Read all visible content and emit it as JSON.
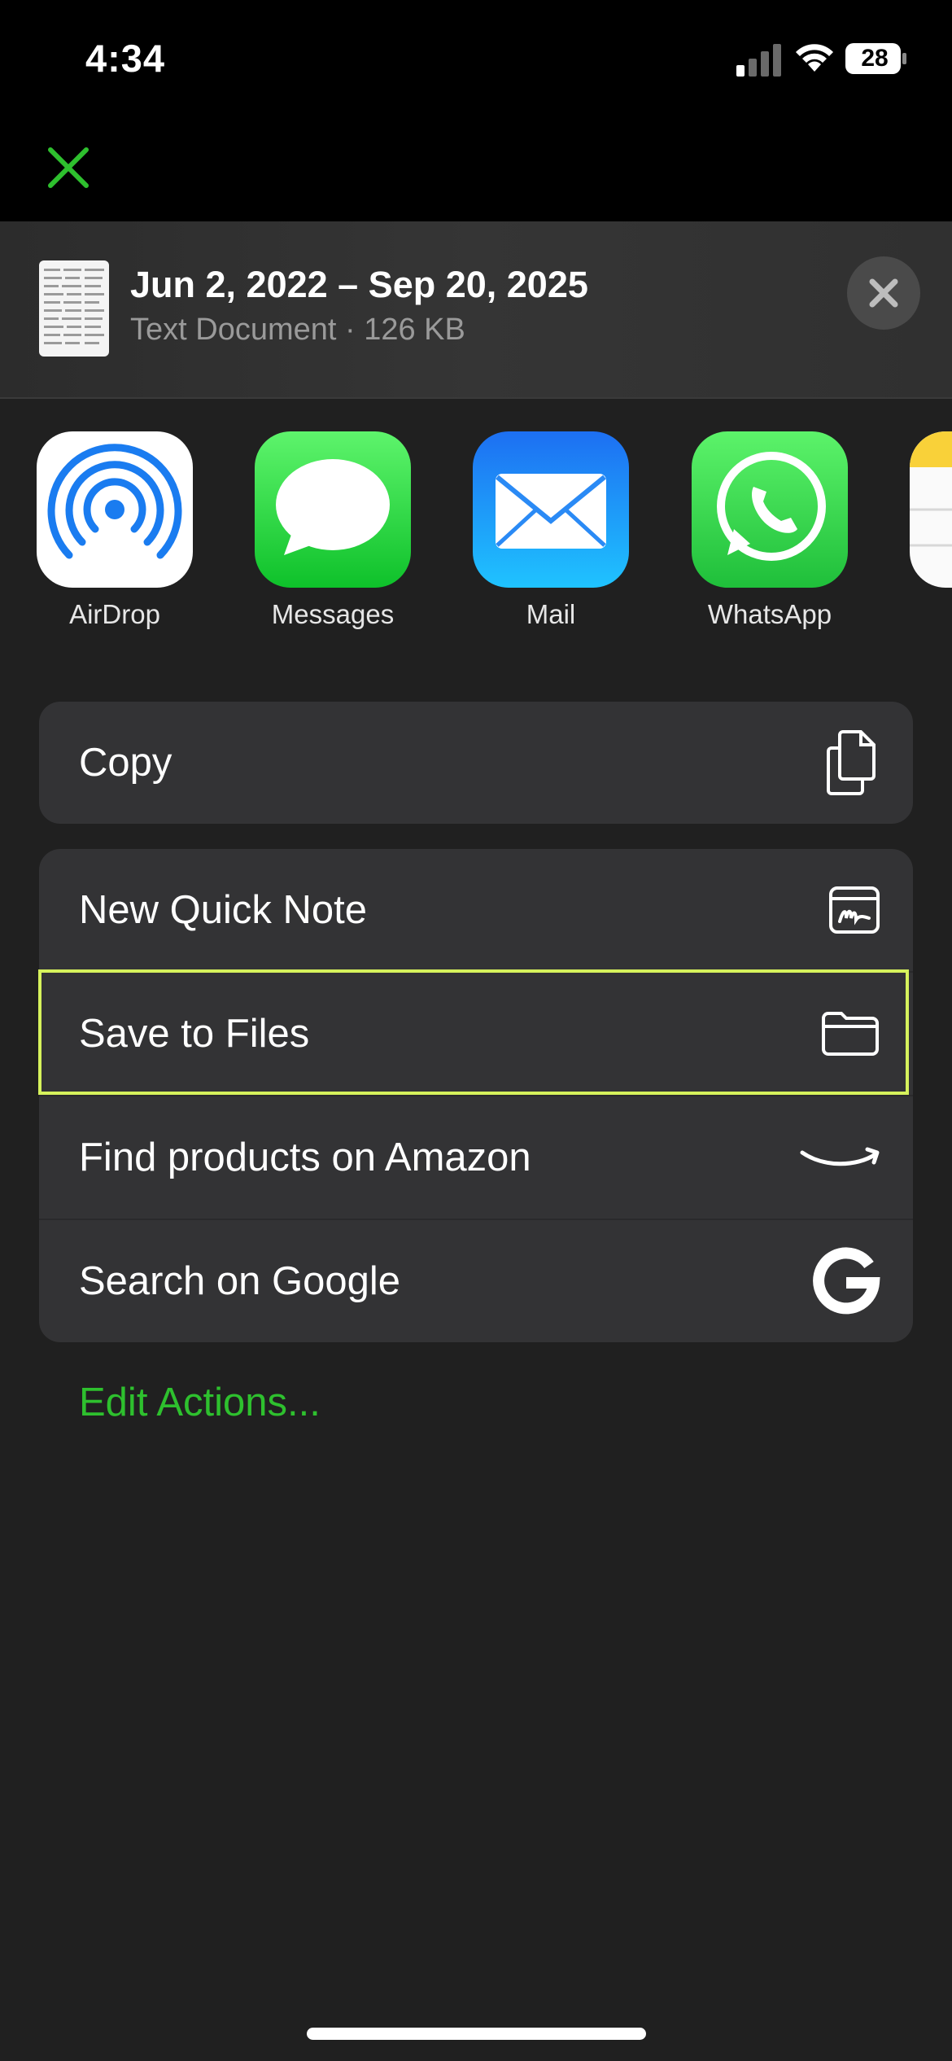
{
  "status_bar": {
    "time": "4:34",
    "battery": "28",
    "icons": [
      "signal-icon",
      "wifi-icon",
      "battery-icon"
    ]
  },
  "top_close_icon": "close-icon",
  "colors": {
    "accent_green": "#2ec02e",
    "highlight": "#d6f25c",
    "sheet_bg": "#202020",
    "row_bg": "#333335"
  },
  "share_header": {
    "title": "Jun 2, 2022 – Sep 20, 2025",
    "subtitle": "Text Document · 126 KB"
  },
  "apps": [
    {
      "label": "AirDrop",
      "icon": "airdrop-icon"
    },
    {
      "label": "Messages",
      "icon": "messages-icon"
    },
    {
      "label": "Mail",
      "icon": "mail-icon"
    },
    {
      "label": "WhatsApp",
      "icon": "whatsapp-icon"
    },
    {
      "label": "",
      "icon": "notes-icon"
    }
  ],
  "actions_group1": [
    {
      "label": "Copy",
      "icon": "copy-icon"
    }
  ],
  "actions_group2": [
    {
      "label": "New Quick Note",
      "icon": "quick-note-icon"
    },
    {
      "label": "Save to Files",
      "icon": "folder-icon",
      "highlighted": true
    },
    {
      "label": "Find products on Amazon",
      "icon": "amazon-icon"
    },
    {
      "label": "Search on Google",
      "icon": "google-icon"
    }
  ],
  "edit_actions": "Edit Actions..."
}
